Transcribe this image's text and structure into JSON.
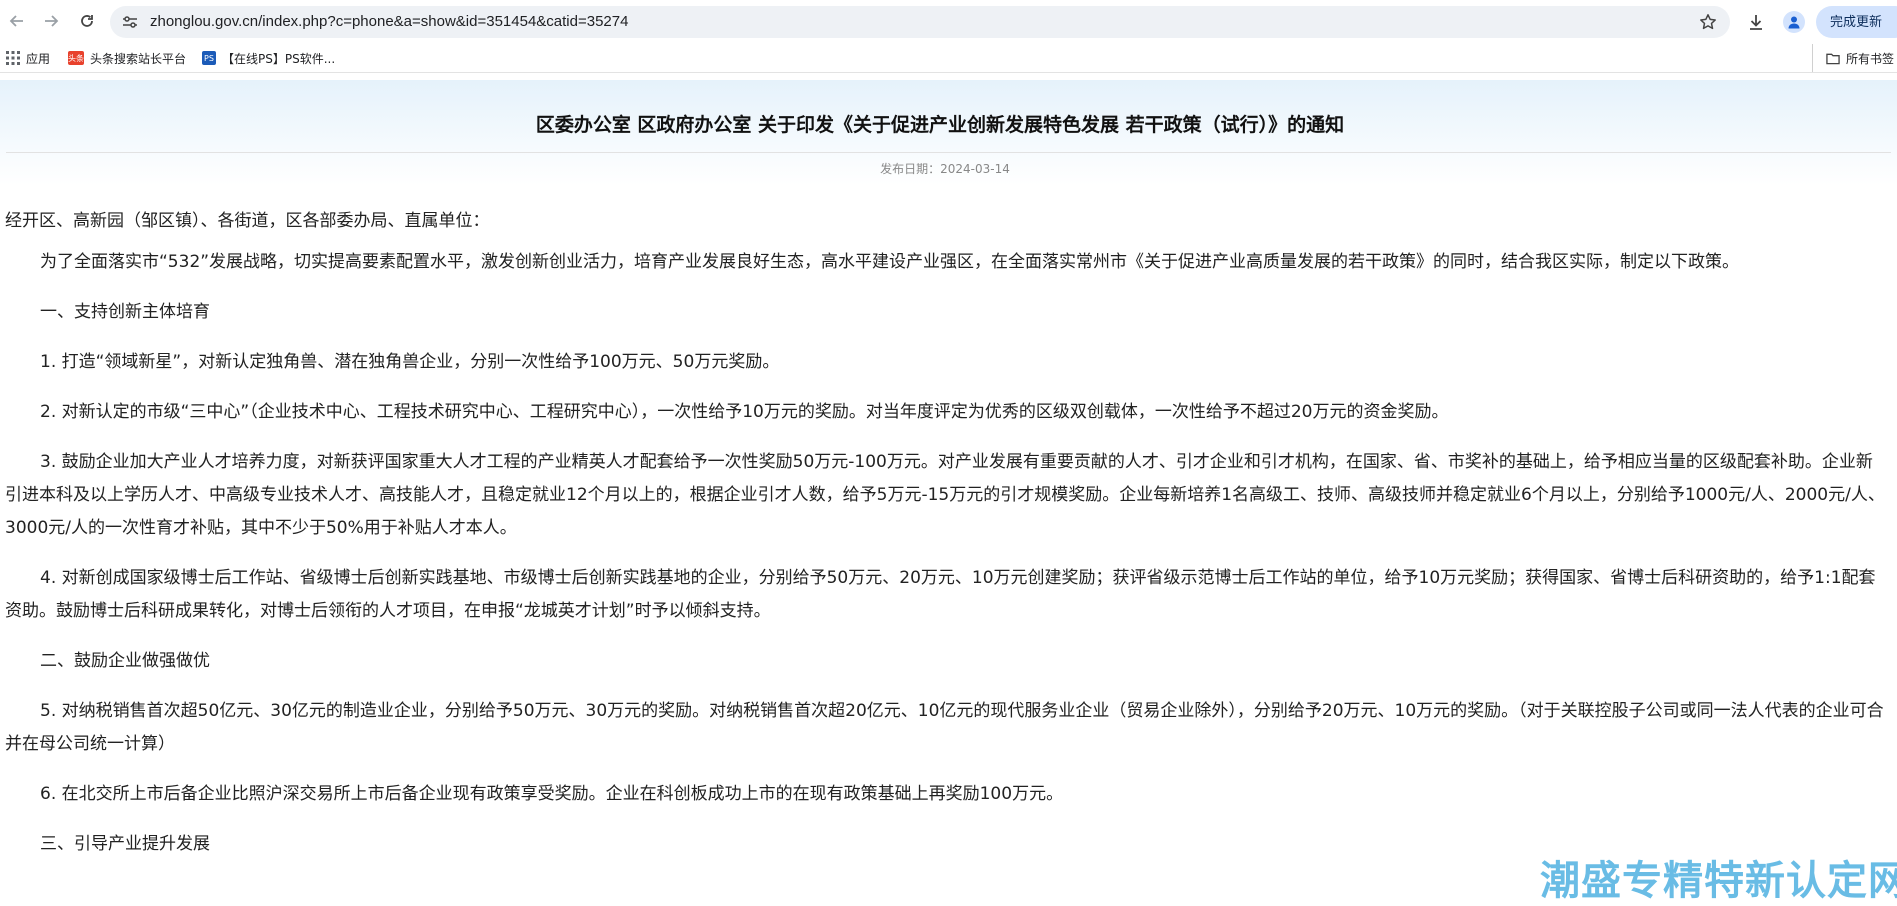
{
  "browser": {
    "url": "zhonglou.gov.cn/index.php?c=phone&a=show&id=351454&catid=35274",
    "update_label": "完成更新",
    "icons": {
      "back": "arrow-left-icon",
      "forward": "arrow-right-icon",
      "reload": "reload-icon",
      "site_info": "tune-icon",
      "bookmark": "star-icon",
      "download": "download-icon",
      "profile": "person-icon"
    }
  },
  "bookmarks": {
    "apps_label": "应用",
    "items": [
      {
        "label": "头条搜索站长平台",
        "icon": "toutiao-icon"
      },
      {
        "label": "【在线PS】PS软件...",
        "icon": "ps-icon"
      }
    ],
    "all_bookmarks_label": "所有书签"
  },
  "document": {
    "title": "区委办公室 区政府办公室 关于印发《关于促进产业创新发展特色发展 若干政策（试行）》的通知",
    "publish_date": "发布日期：2024-03-14",
    "paragraphs": [
      "经开区、高新园（邹区镇）、各街道，区各部委办局、直属单位：",
      "为了全面落实市“532”发展战略，切实提高要素配置水平，激发创新创业活力，培育产业发展良好生态，高水平建设产业强区，在全面落实常州市《关于促进产业高质量发展的若干政策》的同时，结合我区实际，制定以下政策。",
      "一、支持创新主体培育",
      "1. 打造“领域新星”，对新认定独角兽、潜在独角兽企业，分别一次性给予100万元、50万元奖励。",
      "2. 对新认定的市级“三中心”（企业技术中心、工程技术研究中心、工程研究中心），一次性给予10万元的奖励。对当年度评定为优秀的区级双创载体，一次性给予不超过20万元的资金奖励。",
      "3. 鼓励企业加大产业人才培养力度，对新获评国家重大人才工程的产业精英人才配套给予一次性奖励50万元-100万元。对产业发展有重要贡献的人才、引才企业和引才机构，在国家、省、市奖补的基础上，给予相应当量的区级配套补助。企业新引进本科及以上学历人才、中高级专业技术人才、高技能人才，且稳定就业12个月以上的，根据企业引才人数，给予5万元-15万元的引才规模奖励。企业每新培养1名高级工、技师、高级技师并稳定就业6个月以上，分别给予1000元/人、2000元/人、3000元/人的一次性育才补贴，其中不少于50%用于补贴人才本人。",
      "4. 对新创成国家级博士后工作站、省级博士后创新实践基地、市级博士后创新实践基地的企业，分别给予50万元、20万元、10万元创建奖励；获评省级示范博士后工作站的单位，给予10万元奖励；获得国家、省博士后科研资助的，给予1:1配套资助。鼓励博士后科研成果转化，对博士后领衔的人才项目，在申报“龙城英才计划”时予以倾斜支持。",
      "二、鼓励企业做强做优",
      "5. 对纳税销售首次超50亿元、30亿元的制造业企业，分别给予50万元、30万元的奖励。对纳税销售首次超20亿元、10亿元的现代服务业企业（贸易企业除外），分别给予20万元、10万元的奖励。（对于关联控股子公司或同一法人代表的企业可合并在母公司统一计算）",
      "6. 在北交所上市后备企业比照沪深交易所上市后备企业现有政策享受奖励。企业在科创板成功上市的在现有政策基础上再奖励100万元。",
      "三、引导产业提升发展"
    ]
  },
  "watermark": "潮盛专精特新认定网"
}
